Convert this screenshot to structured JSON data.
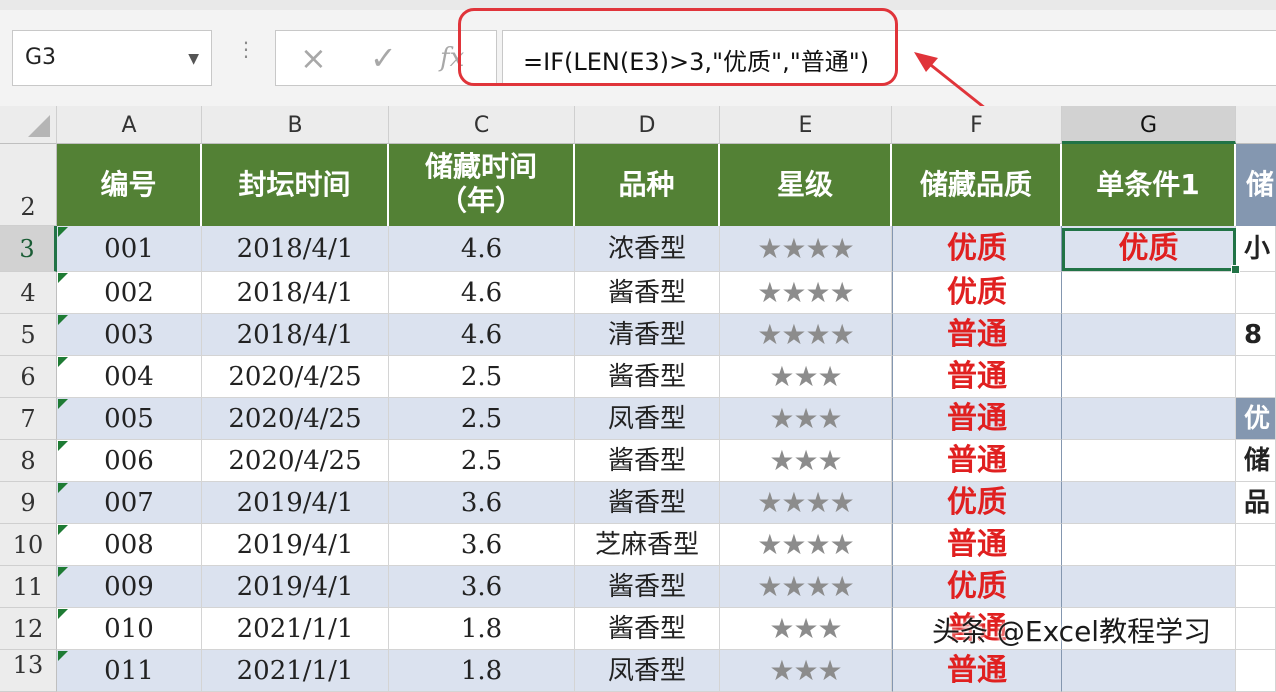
{
  "formula_bar": {
    "name_box": "G3",
    "formula": "=IF(LEN(E3)>3,\"优质\",\"普通\")",
    "cancel_glyph": "×",
    "enter_glyph": "✓",
    "fx_glyph": "fx"
  },
  "annotation_color": "#e0343a",
  "columns": [
    "A",
    "B",
    "C",
    "D",
    "E",
    "F",
    "G"
  ],
  "rows": [
    "2",
    "3",
    "4",
    "5",
    "6",
    "7",
    "8",
    "9",
    "10",
    "11",
    "12",
    "13"
  ],
  "selected": {
    "column": "G",
    "row": "3"
  },
  "header": {
    "A": "编号",
    "B": "封坛时间",
    "C1": "储藏时间",
    "C2": "（年）",
    "D": "品种",
    "E": "星级",
    "F": "储藏品质",
    "G": "单条件1",
    "H": "储"
  },
  "colors": {
    "header_green": "#538135",
    "band_blue": "#dbe2ef",
    "quality_red": "#e02020",
    "right_header_blue": "#8497b0"
  },
  "data": [
    {
      "id": "001",
      "date": "2018/4/1",
      "years": "4.6",
      "type": "浓香型",
      "stars": "★★★★",
      "quality": "优质",
      "g": "优质",
      "h": "小"
    },
    {
      "id": "002",
      "date": "2018/4/1",
      "years": "4.6",
      "type": "酱香型",
      "stars": "★★★★",
      "quality": "优质",
      "g": "",
      "h": ""
    },
    {
      "id": "003",
      "date": "2018/4/1",
      "years": "4.6",
      "type": "清香型",
      "stars": "★★★★",
      "quality": "普通",
      "g": "",
      "h": "8"
    },
    {
      "id": "004",
      "date": "2020/4/25",
      "years": "2.5",
      "type": "酱香型",
      "stars": "★★★",
      "quality": "普通",
      "g": "",
      "h": ""
    },
    {
      "id": "005",
      "date": "2020/4/25",
      "years": "2.5",
      "type": "凤香型",
      "stars": "★★★",
      "quality": "普通",
      "g": "",
      "h": "优"
    },
    {
      "id": "006",
      "date": "2020/4/25",
      "years": "2.5",
      "type": "酱香型",
      "stars": "★★★",
      "quality": "普通",
      "g": "",
      "h": "储"
    },
    {
      "id": "007",
      "date": "2019/4/1",
      "years": "3.6",
      "type": "酱香型",
      "stars": "★★★★",
      "quality": "优质",
      "g": "",
      "h": "品"
    },
    {
      "id": "008",
      "date": "2019/4/1",
      "years": "3.6",
      "type": "芝麻香型",
      "stars": "★★★★",
      "quality": "普通",
      "g": "",
      "h": ""
    },
    {
      "id": "009",
      "date": "2019/4/1",
      "years": "3.6",
      "type": "酱香型",
      "stars": "★★★★",
      "quality": "优质",
      "g": "",
      "h": ""
    },
    {
      "id": "010",
      "date": "2021/1/1",
      "years": "1.8",
      "type": "酱香型",
      "stars": "★★★",
      "quality": "普通",
      "g": "",
      "h": ""
    },
    {
      "id": "011",
      "date": "2021/1/1",
      "years": "1.8",
      "type": "凤香型",
      "stars": "★★★",
      "quality": "普通",
      "g": "",
      "h": ""
    }
  ],
  "watermark": "头条 @Excel教程学习"
}
